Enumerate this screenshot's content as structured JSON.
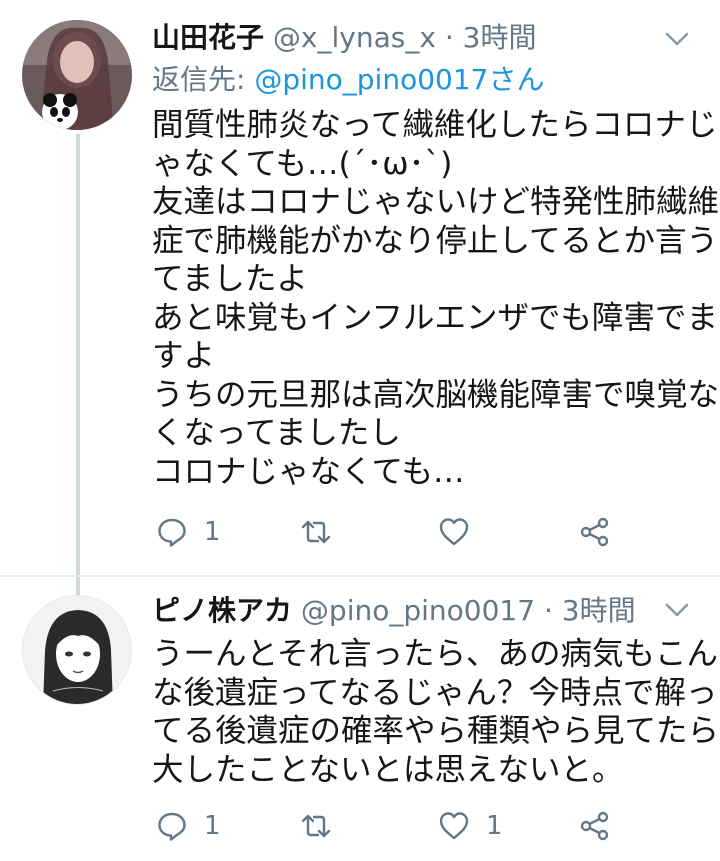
{
  "tweets": [
    {
      "name": "山田花子",
      "handle": "@x_lynas_x",
      "separator": "·",
      "time": "3時間",
      "reply_prefix": "返信先: ",
      "reply_to": "@pino_pino0017さん",
      "lines": [
        "間質性肺炎なって繊維化したらコロナじ",
        "ゃなくても…(´･ω･`)",
        "友達はコロナじゃないけど特発性肺繊維",
        "症で肺機能がかなり停止してるとか言う",
        "てましたよ",
        "あと味覚もインフルエンザでも障害でま",
        "すよ",
        "うちの元旦那は高次脳機能障害で嗅覚な",
        "くなってましたし",
        "コロナじゃなくても…"
      ],
      "actions": {
        "reply_count": "1",
        "retweet_count": "",
        "like_count": ""
      },
      "icons": [
        "reply-icon",
        "retweet-icon",
        "heart-icon",
        "share-icon",
        "chevron-down-icon"
      ]
    },
    {
      "name": "ピノ株アカ",
      "handle": "@pino_pino0017",
      "separator": "·",
      "time": "3時間",
      "lines": [
        "うーんとそれ言ったら、あの病気もこん",
        "な後遺症ってなるじゃん？今時点で解っ",
        "てる後遺症の確率やら種類やら見てたら",
        "大したことないとは思えないと。"
      ],
      "actions": {
        "reply_count": "1",
        "retweet_count": "",
        "like_count": "1"
      },
      "icons": [
        "reply-icon",
        "retweet-icon",
        "heart-icon",
        "share-icon",
        "chevron-down-icon"
      ]
    }
  ],
  "colors": {
    "text": "#14171a",
    "secondary": "#657786",
    "link": "#1b95e0",
    "thread_line": "#cfd9de"
  }
}
